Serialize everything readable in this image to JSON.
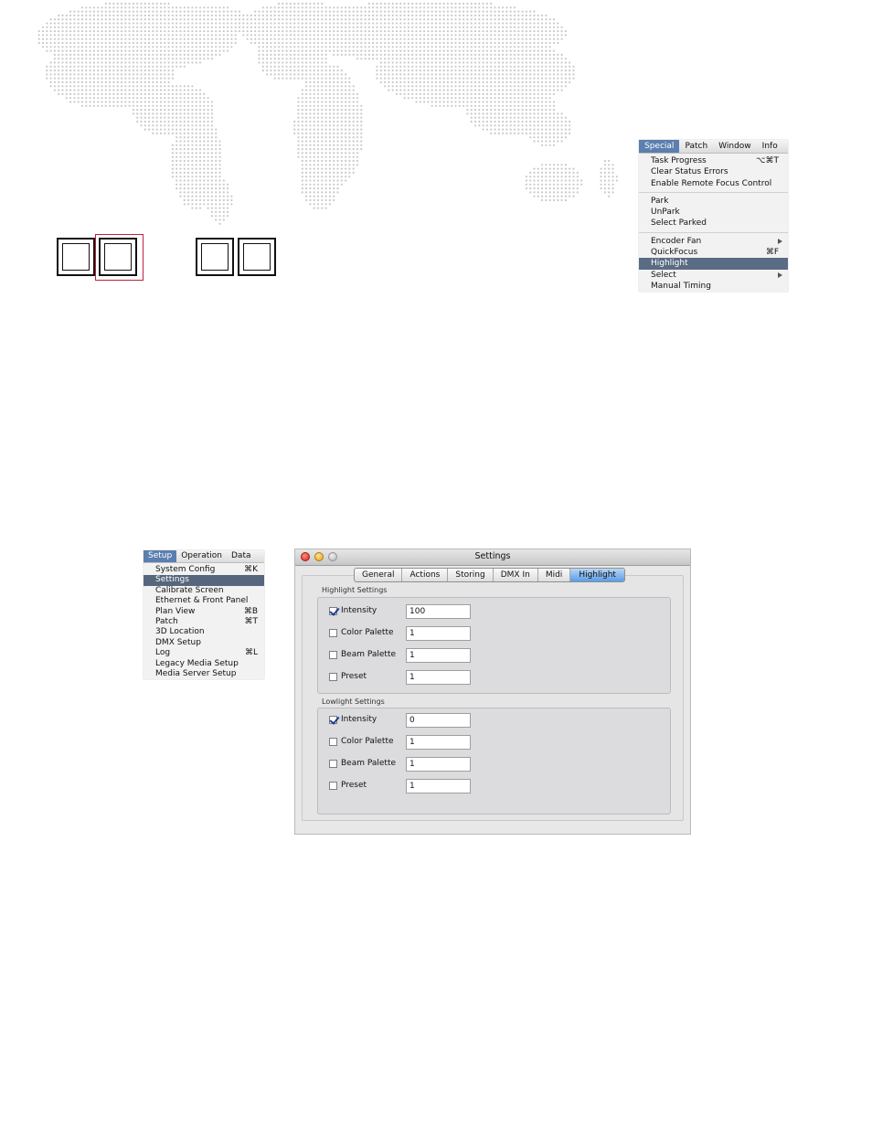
{
  "special_menu": {
    "menubar": [
      "Special",
      "Patch",
      "Window",
      "Info"
    ],
    "active": "Special",
    "groups": [
      [
        {
          "label": "Task Progress",
          "shortcut": "⌥⌘T"
        },
        {
          "label": "Clear Status Errors",
          "shortcut": ""
        },
        {
          "label": "Enable Remote Focus Control",
          "shortcut": ""
        }
      ],
      [
        {
          "label": "Park",
          "shortcut": ""
        },
        {
          "label": "UnPark",
          "shortcut": ""
        },
        {
          "label": "Select Parked",
          "shortcut": ""
        }
      ],
      [
        {
          "label": "Encoder Fan",
          "shortcut": "",
          "submenu": true
        },
        {
          "label": "QuickFocus",
          "shortcut": "⌘F"
        },
        {
          "label": "Highlight",
          "shortcut": "",
          "selected": true
        },
        {
          "label": "Select",
          "shortcut": "",
          "submenu": true
        },
        {
          "label": "Manual Timing",
          "shortcut": ""
        }
      ]
    ]
  },
  "setup_menu": {
    "menubar": [
      "Setup",
      "Operation",
      "Data"
    ],
    "active": "Setup",
    "items": [
      {
        "label": "System Config",
        "shortcut": "⌘K"
      },
      {
        "label": "Settings",
        "shortcut": "",
        "selected": true
      },
      {
        "label": "Calibrate Screen",
        "shortcut": ""
      },
      {
        "label": "Ethernet & Front Panel",
        "shortcut": ""
      },
      {
        "label": "Plan View",
        "shortcut": "⌘B"
      },
      {
        "label": "Patch",
        "shortcut": "⌘T"
      },
      {
        "label": "3D Location",
        "shortcut": ""
      },
      {
        "label": "DMX Setup",
        "shortcut": ""
      },
      {
        "label": "Log",
        "shortcut": "⌘L"
      },
      {
        "label": "Legacy Media Setup",
        "shortcut": ""
      },
      {
        "label": "Media Server Setup",
        "shortcut": ""
      }
    ]
  },
  "settings": {
    "title": "Settings",
    "tabs": [
      "General",
      "Actions",
      "Storing",
      "DMX In",
      "Midi",
      "Highlight"
    ],
    "active_tab": "Highlight",
    "highlight": {
      "label": "Highlight Settings",
      "rows": [
        {
          "label": "Intensity",
          "checked": true,
          "value": "100"
        },
        {
          "label": "Color Palette",
          "checked": false,
          "value": "1"
        },
        {
          "label": "Beam Palette",
          "checked": false,
          "value": "1"
        },
        {
          "label": "Preset",
          "checked": false,
          "value": "1"
        }
      ]
    },
    "lowlight": {
      "label": "Lowlight Settings",
      "rows": [
        {
          "label": "Intensity",
          "checked": true,
          "value": "0"
        },
        {
          "label": "Color Palette",
          "checked": false,
          "value": "1"
        },
        {
          "label": "Beam Palette",
          "checked": false,
          "value": "1"
        },
        {
          "label": "Preset",
          "checked": false,
          "value": "1"
        }
      ]
    }
  }
}
